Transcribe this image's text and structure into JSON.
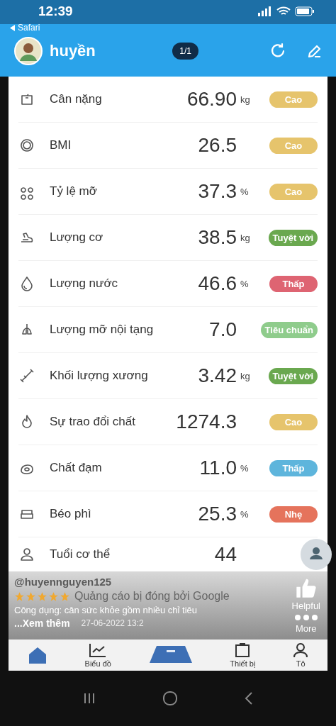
{
  "status_bar": {
    "time": "12:39",
    "back_app": "Safari"
  },
  "header": {
    "name": "huyền",
    "page_indicator": "1/1"
  },
  "metrics": [
    {
      "label": "Cân nặng",
      "value": "66.90",
      "unit": "kg",
      "status": "Cao",
      "color": "#e6c46c"
    },
    {
      "label": "BMI",
      "value": "26.5",
      "status": "Cao",
      "color": "#e6c46c"
    },
    {
      "label": "Tỷ lệ mỡ",
      "value": "37.3",
      "unit": "%",
      "status": "Cao",
      "color": "#e6c46c"
    },
    {
      "label": "Lượng cơ",
      "value": "38.5",
      "unit": "kg",
      "status": "Tuyệt vời",
      "color": "#6aa84f"
    },
    {
      "label": "Lượng nước",
      "value": "46.6",
      "unit": "%",
      "status": "Thấp",
      "color": "#de6472"
    },
    {
      "label": "Lượng mỡ nội tạng",
      "value": "7.0",
      "status": "Tiêu chuẩn",
      "color": "#8fcc8c"
    },
    {
      "label": "Khối lượng xương",
      "value": "3.42",
      "unit": "kg",
      "status": "Tuyệt vời",
      "color": "#6aa84f"
    },
    {
      "label": "Sự trao đổi chất",
      "value": "1274.3",
      "status": "Cao",
      "color": "#e6c46c"
    },
    {
      "label": "Chất đạm",
      "value": "11.0",
      "unit": "%",
      "status": "Thấp",
      "color": "#5eb5dc"
    },
    {
      "label": "Béo phì",
      "value": "25.3",
      "unit": "%",
      "status": "Nhẹ",
      "color": "#e5735c"
    },
    {
      "label": "Tuổi cơ thể",
      "value": "44"
    }
  ],
  "overlay": {
    "username": "@huyennguyen125",
    "stars": 5,
    "ad_notice": "Quảng cáo bị đóng bởi Google",
    "description": "Công dụng: cân sức khỏe gồm nhiều chỉ tiêu",
    "more_link": "...Xem thêm",
    "date": "27-06-2022 13:2",
    "helpful": "Helpful",
    "more": "More"
  },
  "bottom_nav": [
    {
      "label": "Biểu đồ"
    },
    {
      "label": "Thiết bị"
    },
    {
      "label": "Tô"
    }
  ]
}
